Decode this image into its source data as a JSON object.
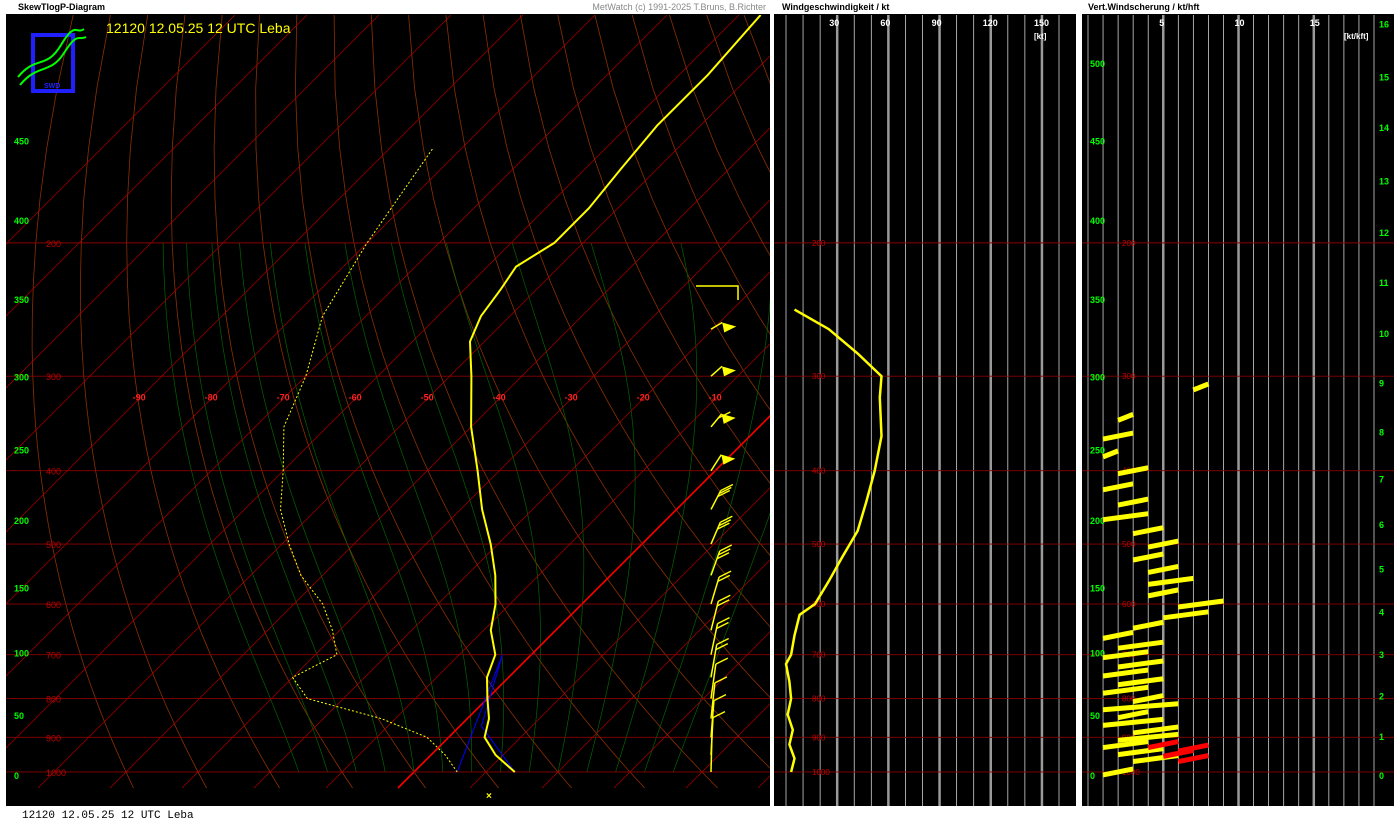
{
  "app": {
    "panel_skewt_title": "SkewTlogP-Diagram",
    "copyright": "MetWatch  (c) 1991-2025 T.Bruns, B.Richter",
    "panel_wind_title": "Windgeschwindigkeit / kt",
    "panel_shear_title": "Vert.Windscherung / kt/hft",
    "station_label": "12120 12.05.25 12 UTC Leba",
    "caption": "12120  12.05.25  12 UTC Leba",
    "logo_text": "SWD"
  },
  "colors": {
    "background": "#000000",
    "temperature": "#ffff00",
    "dewpoint": "#ffff00",
    "isobar": "#8b0000",
    "isotherm": "#b00000",
    "dry_adiabat": "#8b3000",
    "moist_adiabat": "#006400",
    "zero_isotherm": "#ff0000",
    "axis_labels": "#00ff00",
    "parcel": "#0000ff",
    "shear_low": "#ff0000"
  },
  "chart_data": [
    {
      "type": "line",
      "chart": "skew-t log-p",
      "title": "12120 12.05.25 12 UTC Leba",
      "pressure_levels_hpa": [
        1000,
        900,
        800,
        700,
        600,
        500,
        400,
        300,
        200
      ],
      "isotherm_labels_c": [
        -90,
        -80,
        -70,
        -60,
        -50,
        -40,
        -30,
        -20,
        -10
      ],
      "left_axis_hft": [
        0,
        50,
        100,
        150,
        200,
        250,
        300,
        350,
        400,
        450
      ],
      "right_axis_hft": [
        500,
        450,
        400,
        350,
        300,
        250,
        200,
        150,
        100,
        50,
        0
      ],
      "right_axis_km": [
        16,
        15,
        14,
        13,
        12,
        11,
        10,
        9,
        8,
        7,
        6,
        5,
        4,
        3,
        2,
        1,
        0
      ],
      "temperature_profile": [
        [
          1000,
          14
        ],
        [
          950,
          9
        ],
        [
          900,
          5
        ],
        [
          850,
          3
        ],
        [
          800,
          0
        ],
        [
          750,
          -3
        ],
        [
          700,
          -5
        ],
        [
          650,
          -9
        ],
        [
          600,
          -12
        ],
        [
          550,
          -16
        ],
        [
          500,
          -21
        ],
        [
          450,
          -27
        ],
        [
          400,
          -33
        ],
        [
          350,
          -40
        ],
        [
          300,
          -47
        ],
        [
          270,
          -52
        ],
        [
          250,
          -54
        ],
        [
          230,
          -55
        ],
        [
          215,
          -56
        ],
        [
          200,
          -54
        ],
        [
          180,
          -54
        ],
        [
          160,
          -55
        ],
        [
          140,
          -56
        ],
        [
          120,
          -56
        ],
        [
          100,
          -57
        ]
      ],
      "dewpoint_profile": [
        [
          1000,
          6
        ],
        [
          950,
          2
        ],
        [
          900,
          -3
        ],
        [
          850,
          -12
        ],
        [
          800,
          -25
        ],
        [
          750,
          -30
        ],
        [
          700,
          -27
        ],
        [
          650,
          -31
        ],
        [
          600,
          -36
        ],
        [
          550,
          -43
        ],
        [
          500,
          -49
        ],
        [
          450,
          -55
        ],
        [
          400,
          -60
        ],
        [
          350,
          -66
        ],
        [
          300,
          -70
        ],
        [
          250,
          -76
        ],
        [
          200,
          -80
        ],
        [
          150,
          -84
        ]
      ],
      "wind_barbs": [
        [
          1000,
          5,
          5
        ],
        [
          950,
          10,
          10
        ],
        [
          900,
          12,
          15
        ],
        [
          850,
          16,
          20
        ],
        [
          800,
          18,
          25
        ],
        [
          750,
          20,
          30
        ],
        [
          700,
          22,
          35
        ],
        [
          650,
          25,
          40
        ],
        [
          600,
          28,
          45
        ],
        [
          550,
          32,
          50
        ],
        [
          500,
          35,
          55
        ],
        [
          450,
          38,
          60
        ],
        [
          400,
          55,
          65
        ],
        [
          350,
          60,
          70
        ],
        [
          300,
          58,
          75
        ],
        [
          260,
          52,
          80
        ]
      ]
    },
    {
      "type": "line",
      "chart": "wind-speed-profile",
      "title": "Windgeschwindigkeit / kt",
      "x_ticks": [
        30,
        60,
        90,
        120,
        150
      ],
      "x_unit": "[kt]",
      "xlim": [
        0,
        160
      ],
      "y": "pressure_hpa",
      "points": [
        [
          1000,
          3
        ],
        [
          960,
          5
        ],
        [
          920,
          2
        ],
        [
          880,
          4
        ],
        [
          840,
          1
        ],
        [
          800,
          3
        ],
        [
          760,
          2
        ],
        [
          720,
          0
        ],
        [
          700,
          3
        ],
        [
          660,
          5
        ],
        [
          620,
          8
        ],
        [
          600,
          17
        ],
        [
          560,
          25
        ],
        [
          520,
          33
        ],
        [
          480,
          42
        ],
        [
          440,
          47
        ],
        [
          400,
          52
        ],
        [
          360,
          56
        ],
        [
          320,
          55
        ],
        [
          300,
          56
        ],
        [
          280,
          42
        ],
        [
          260,
          25
        ],
        [
          245,
          5
        ]
      ]
    },
    {
      "type": "scatter",
      "chart": "vertical-wind-shear",
      "title": "Vert.Windscherung / kt/hft",
      "x_ticks": [
        5,
        10,
        15
      ],
      "x_unit": "[kt/kft]",
      "xlim": [
        0,
        19
      ],
      "segments_yellow": [
        [
          1000,
          1,
          3
        ],
        [
          960,
          3,
          6
        ],
        [
          940,
          2,
          5
        ],
        [
          920,
          1,
          4
        ],
        [
          900,
          2,
          6
        ],
        [
          880,
          3,
          6
        ],
        [
          860,
          1,
          5
        ],
        [
          840,
          2,
          4
        ],
        [
          820,
          1,
          6
        ],
        [
          800,
          3,
          5
        ],
        [
          780,
          1,
          4
        ],
        [
          760,
          2,
          5
        ],
        [
          740,
          1,
          4
        ],
        [
          720,
          2,
          5
        ],
        [
          700,
          1,
          4
        ],
        [
          680,
          2,
          5
        ],
        [
          660,
          1,
          3
        ],
        [
          640,
          3,
          5
        ],
        [
          620,
          5,
          8
        ],
        [
          600,
          6,
          9
        ],
        [
          580,
          4,
          6
        ],
        [
          560,
          4,
          7
        ],
        [
          540,
          4,
          6
        ],
        [
          520,
          3,
          5
        ],
        [
          500,
          4,
          6
        ],
        [
          480,
          3,
          5
        ],
        [
          460,
          1,
          4
        ],
        [
          440,
          2,
          4
        ],
        [
          420,
          1,
          3
        ],
        [
          400,
          2,
          4
        ],
        [
          380,
          1,
          2
        ],
        [
          360,
          1,
          3
        ],
        [
          340,
          2,
          3
        ],
        [
          310,
          7,
          8
        ]
      ],
      "segments_red": [
        [
          920,
          4,
          6
        ],
        [
          930,
          6,
          8
        ],
        [
          945,
          5,
          7
        ],
        [
          960,
          6,
          8
        ]
      ]
    }
  ]
}
